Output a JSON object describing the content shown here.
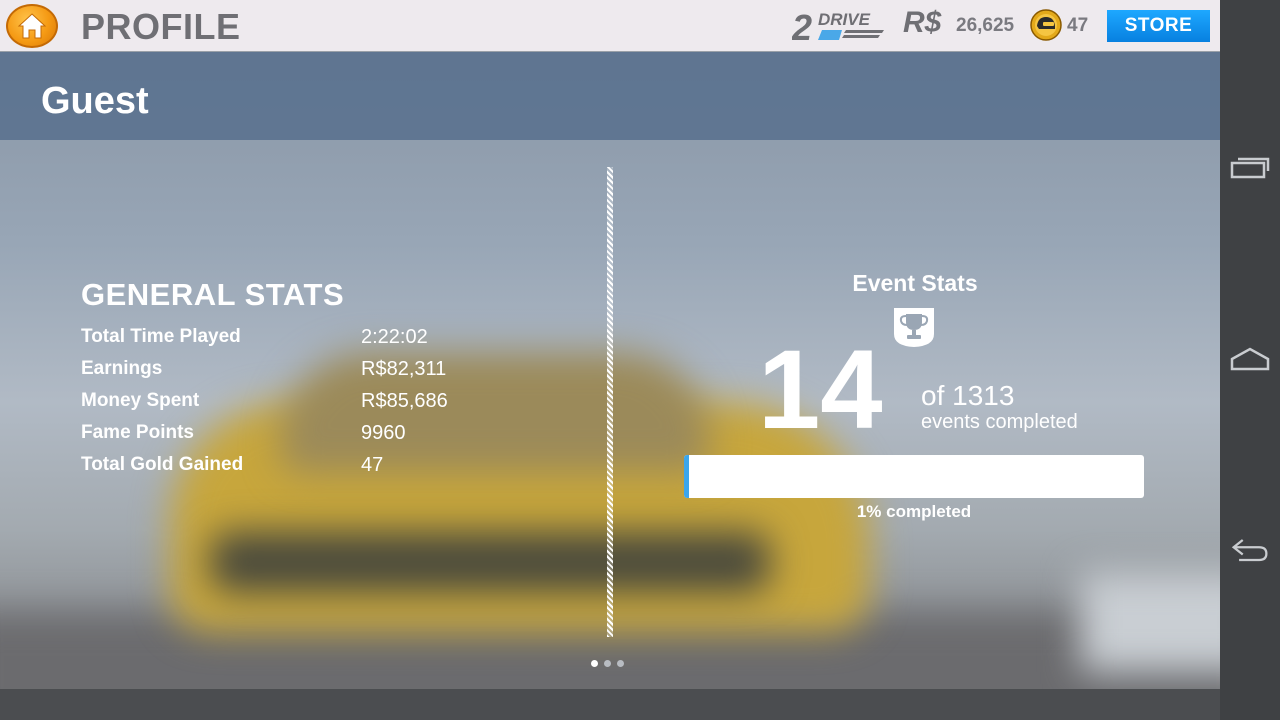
{
  "header": {
    "title": "PROFILE",
    "brand_mark": "2DRIVE",
    "currency_symbol": "R$",
    "currency_amount": "26,625",
    "gold_amount": "47",
    "store_label": "STORE"
  },
  "profile": {
    "player_name": "Guest"
  },
  "general_stats": {
    "title": "GENERAL STATS",
    "rows": [
      {
        "label": "Total Time Played",
        "value": "2:22:02"
      },
      {
        "label": "Earnings",
        "value": "R$82,311"
      },
      {
        "label": "Money Spent",
        "value": "R$85,686"
      },
      {
        "label": "Fame Points",
        "value": "9960"
      },
      {
        "label": "Total Gold Gained",
        "value": "47"
      }
    ]
  },
  "event_stats": {
    "title": "Event Stats",
    "completed": "14",
    "total_text": "of 1313",
    "caption": "events completed",
    "progress_fraction": 0.01,
    "progress_caption": "1% completed"
  },
  "pagination": {
    "count": 3,
    "active": 0
  },
  "icons": {
    "home": "home-icon",
    "gold": "gold-helmet-icon",
    "trophy": "trophy-icon",
    "nav_recents": "recent-apps-icon",
    "nav_home": "android-home-icon",
    "nav_back": "back-arrow-icon"
  },
  "colors": {
    "store": "#0a8cf0",
    "home_button": "#f59a14",
    "progress_fill": "#3ba6ec",
    "header_band": "#566e8c"
  }
}
